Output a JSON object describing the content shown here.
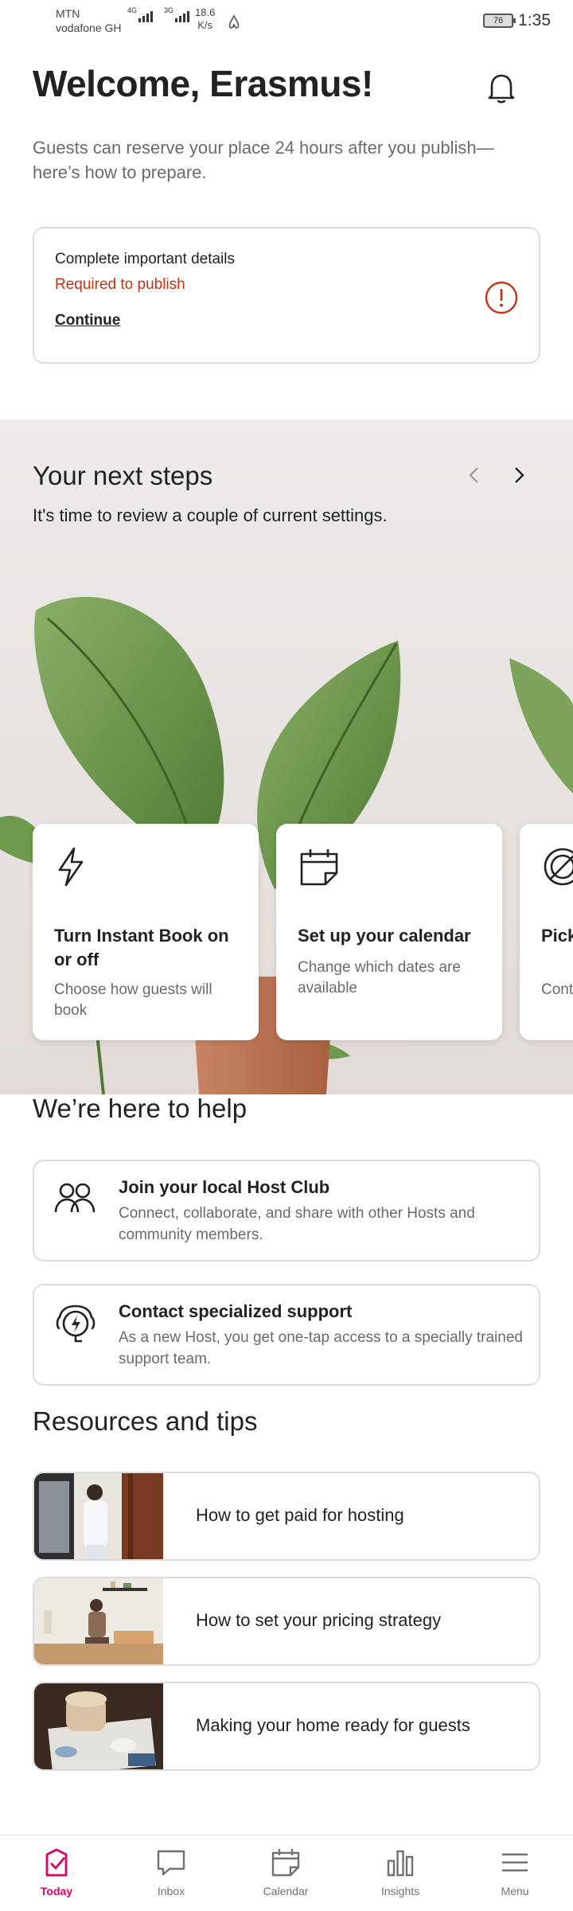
{
  "status_bar": {
    "carrier1": "MTN",
    "carrier2": "vodafone GH",
    "net1": "4G",
    "net2": "3G",
    "speed_value": "18.6",
    "speed_unit": "K/s",
    "battery": "76",
    "time": "1:35"
  },
  "header": {
    "title": "Welcome, Erasmus!",
    "intro": "Guests can reserve your place 24 hours after you publish—here’s how to prepare."
  },
  "important_card": {
    "title": "Complete important details",
    "subtitle": "Required to publish",
    "link": "Continue",
    "alert_color": "#c13515"
  },
  "next_steps": {
    "title": "Your next steps",
    "subtitle": "It's time to review a couple of current settings.",
    "cards": [
      {
        "title": "Turn Instant Book on or off",
        "subtitle": "Choose how guests will book",
        "icon": "lightning-icon"
      },
      {
        "title": "Set up your calendar",
        "subtitle": "Change which dates are available",
        "icon": "calendar-icon"
      },
      {
        "title": "Pick can",
        "subtitle": "Cont",
        "icon": "cancel-circle-icon"
      }
    ]
  },
  "help": {
    "title": "We’re here to help",
    "items": [
      {
        "title": "Join your local Host Club",
        "subtitle": "Connect, collaborate, and share with other Hosts and community members.",
        "icon": "people-group-icon"
      },
      {
        "title": "Contact specialized support",
        "subtitle": "As a new Host, you get one-tap access to a specially trained support team.",
        "icon": "support-headset-icon"
      }
    ]
  },
  "resources": {
    "title": "Resources and tips",
    "items": [
      {
        "label": "How to get paid for hosting"
      },
      {
        "label": "How to set your pricing strategy"
      },
      {
        "label": "Making your home ready for guests"
      }
    ]
  },
  "bottom_nav": {
    "active_color": "#d70466",
    "items": [
      {
        "label": "Today",
        "icon": "today-check-icon"
      },
      {
        "label": "Inbox",
        "icon": "inbox-bubble-icon"
      },
      {
        "label": "Calendar",
        "icon": "calendar-icon"
      },
      {
        "label": "Insights",
        "icon": "insights-bars-icon"
      },
      {
        "label": "Menu",
        "icon": "menu-icon"
      }
    ]
  }
}
